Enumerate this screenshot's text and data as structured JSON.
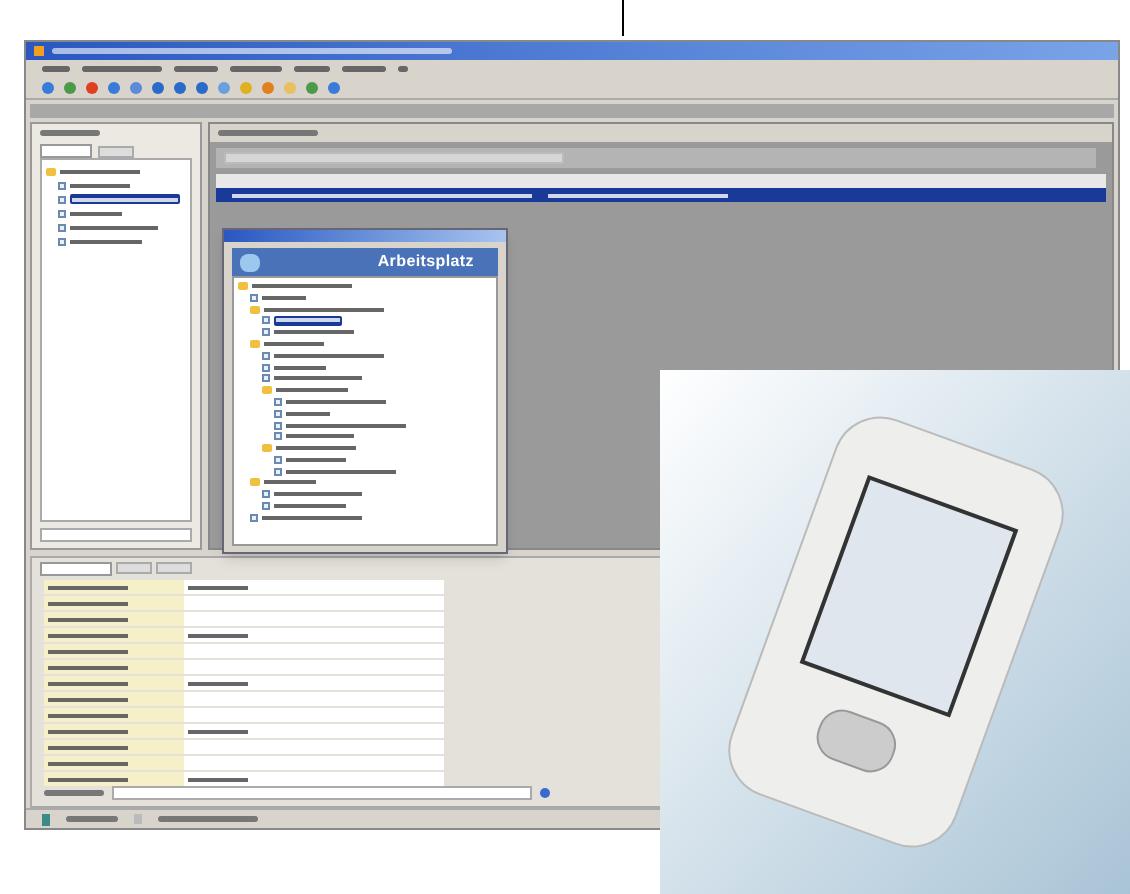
{
  "sidebar": {
    "tabs": [
      {
        "selected": true
      },
      {
        "selected": false
      }
    ],
    "tree": [
      {
        "selected": false,
        "children": [
          {
            "selected": false
          },
          {
            "selected": true
          },
          {
            "selected": false
          },
          {
            "selected": false
          },
          {
            "selected": false
          }
        ]
      }
    ]
  },
  "table": {
    "rows": [
      {
        "selected": true
      }
    ]
  },
  "detail_panel": {
    "tabs": [
      {
        "selected": true
      },
      {
        "selected": false
      },
      {
        "selected": false
      }
    ]
  },
  "workspace_window": {
    "banner": "Arbeitsplatz",
    "tree": [
      {
        "selected": false,
        "children": [
          {
            "selected": false
          },
          {
            "selected": false,
            "children": [
              {
                "selected": true
              },
              {
                "selected": false
              }
            ]
          },
          {
            "selected": false,
            "children": [
              {
                "selected": false
              },
              {
                "selected": false
              },
              {
                "selected": false
              },
              {
                "selected": false,
                "children": [
                  {
                    "selected": false
                  },
                  {
                    "selected": false
                  },
                  {
                    "selected": false
                  },
                  {
                    "selected": false
                  }
                ]
              },
              {
                "selected": false,
                "children": [
                  {
                    "selected": false
                  },
                  {
                    "selected": false
                  }
                ]
              }
            ]
          },
          {
            "selected": false,
            "children": [
              {
                "selected": false
              },
              {
                "selected": false
              }
            ]
          },
          {
            "selected": false
          }
        ]
      }
    ]
  }
}
